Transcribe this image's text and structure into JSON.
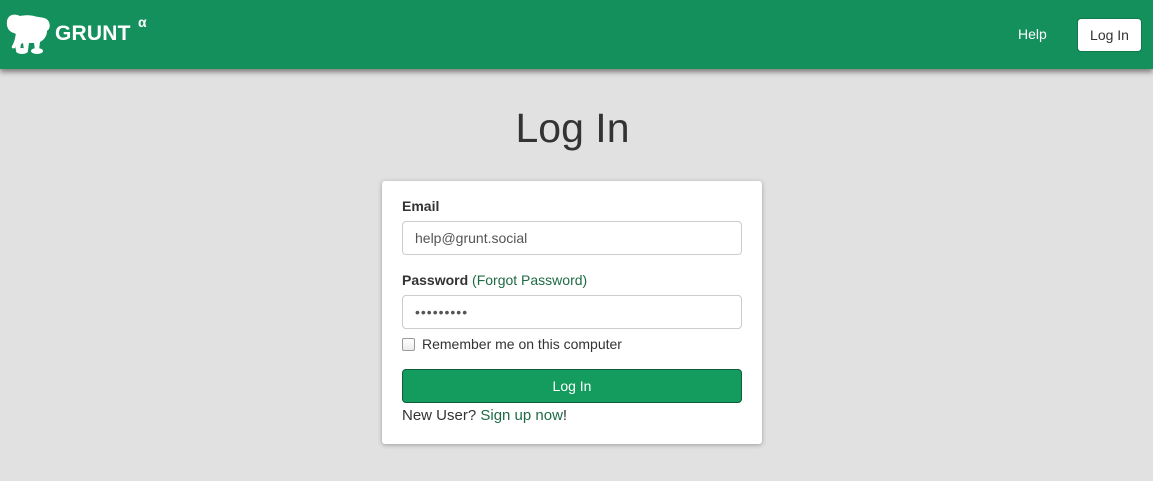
{
  "header": {
    "brand_name": "GRUNT",
    "brand_superscript": "α",
    "logo_icon": "elephant-logo-icon",
    "help_label": "Help",
    "login_label": "Log In"
  },
  "page": {
    "title": "Log In"
  },
  "form": {
    "email_label": "Email",
    "email_value": "help@grunt.social",
    "password_label": "Password",
    "forgot_password_label": "(Forgot Password)",
    "password_value": "•••••••••",
    "remember_label": "Remember me on this computer",
    "remember_checked": false,
    "submit_label": "Log In",
    "new_user_prefix": "New User? ",
    "signup_label": "Sign up now",
    "new_user_suffix": "!"
  },
  "colors": {
    "navbar": "#14905c",
    "page_background": "#e1e1e1",
    "primary_button": "#149b5e",
    "link": "#1e6b45"
  }
}
